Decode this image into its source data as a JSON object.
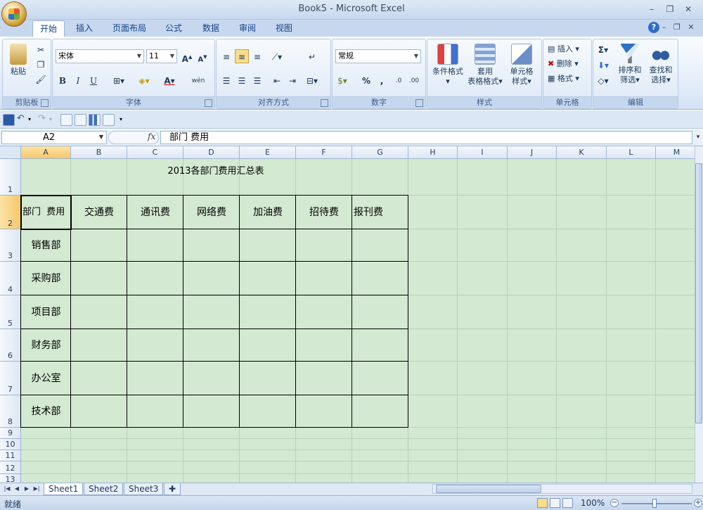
{
  "window": {
    "title": "Book5 - Microsoft Excel"
  },
  "tabs": [
    "开始",
    "插入",
    "页面布局",
    "公式",
    "数据",
    "审阅",
    "视图"
  ],
  "active_tab": "开始",
  "ribbon": {
    "clipboard": {
      "paste": "粘贴",
      "label": "剪贴板"
    },
    "font": {
      "name": "宋体",
      "size": "11",
      "bold": "B",
      "italic": "I",
      "underline": "U",
      "phonetic": "wén",
      "label": "字体"
    },
    "alignment": {
      "label": "对齐方式"
    },
    "number": {
      "format": "常规",
      "percent": "%",
      "comma": ",",
      "label": "数字"
    },
    "styles": {
      "conditional_1": "条件格式",
      "table_1": "套用",
      "table_2": "表格格式",
      "cell_1": "单元格",
      "cell_2": "样式",
      "label": "样式"
    },
    "cells": {
      "insert": "插入",
      "delete": "删除",
      "format": "格式",
      "label": "单元格"
    },
    "editing": {
      "sum": "Σ",
      "sort_1": "排序和",
      "sort_2": "筛选",
      "find_1": "查找和",
      "find_2": "选择",
      "label": "编辑"
    }
  },
  "formula_bar": {
    "name_box": "A2",
    "fx": "fx",
    "content": "部门  费用"
  },
  "columns": [
    "A",
    "B",
    "C",
    "D",
    "E",
    "F",
    "G",
    "H",
    "I",
    "J",
    "K",
    "L",
    "M"
  ],
  "rows": [
    "1",
    "2",
    "3",
    "4",
    "5",
    "6",
    "7",
    "8",
    "9",
    "10",
    "11",
    "12",
    "13"
  ],
  "sheet": {
    "title": "2013各部门费用汇总表",
    "headers": [
      "部门  费用",
      "交通费",
      "通讯费",
      "网络费",
      "加油费",
      "招待费",
      "报刊费"
    ],
    "departments": [
      "销售部",
      "采购部",
      "项目部",
      "财务部",
      "办公室",
      "技术部"
    ]
  },
  "sheet_tabs": [
    "Sheet1",
    "Sheet2",
    "Sheet3"
  ],
  "active_sheet": "Sheet1",
  "status": {
    "text": "就绪",
    "zoom": "100%"
  },
  "colors": {
    "grid_bg": "#d3e9d1",
    "ribbon_text": "#15428b",
    "selected_header": "#f6c76a"
  }
}
